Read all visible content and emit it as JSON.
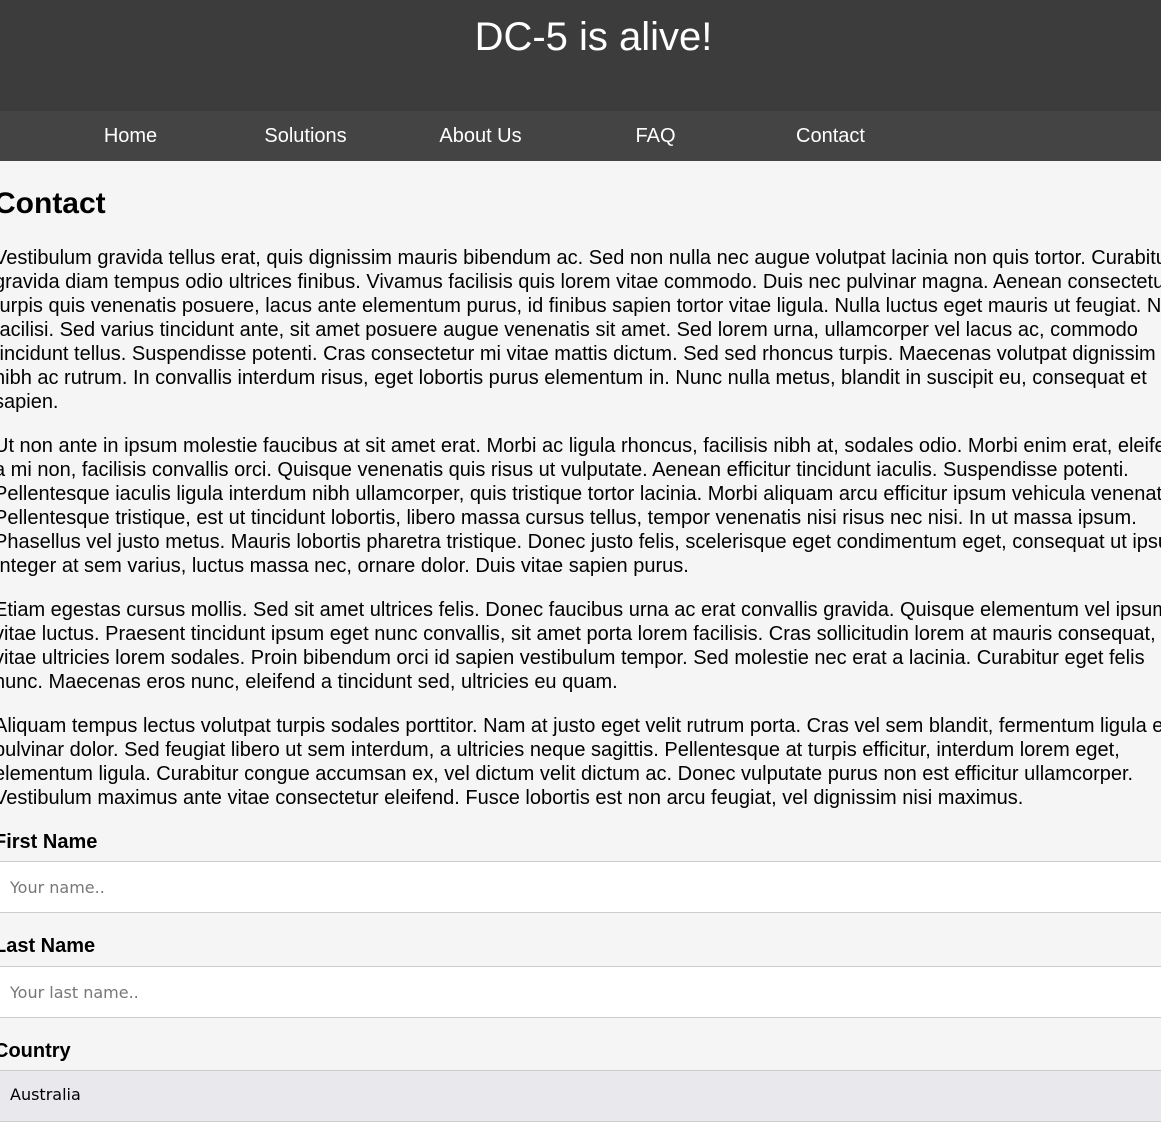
{
  "header": {
    "title": "DC-5 is alive!"
  },
  "nav": {
    "items": [
      {
        "label": "Home"
      },
      {
        "label": "Solutions"
      },
      {
        "label": "About Us"
      },
      {
        "label": "FAQ"
      },
      {
        "label": "Contact"
      }
    ]
  },
  "main": {
    "title": "Contact",
    "paragraphs": [
      {
        "lines": [
          "Vestibulum gravida tellus erat, quis dignissim mauris bibendum ac. Sed non nulla nec augue volutpat lacinia non quis tortor. Curabitur",
          "gravida diam tempus odio ultrices finibus. Vivamus facilisis quis lorem vitae commodo. Duis nec pulvinar magna. Aenean consectetur",
          "turpis quis venenatis posuere, lacus ante elementum purus, id finibus sapien tortor vitae ligula. Nulla luctus eget mauris ut feugiat. Nam",
          "facilisi. Sed varius tincidunt ante, sit amet posuere augue venenatis sit amet. Sed lorem urna, ullamcorper vel lacus ac, commodo",
          "tincidunt tellus. Suspendisse potenti. Cras consectetur mi vitae mattis dictum. Sed sed rhoncus turpis. Maecenas volutpat dignissim",
          "nibh ac rutrum. In convallis interdum risus, eget lobortis purus elementum in. Nunc nulla metus, blandit in suscipit eu, consequat et",
          "sapien."
        ]
      },
      {
        "lines": [
          "Ut non ante in ipsum molestie faucibus at sit amet erat. Morbi ac ligula rhoncus, facilisis nibh at, sodales odio. Morbi enim erat, eleifend",
          "a mi non, facilisis convallis orci. Quisque venenatis quis risus ut vulputate. Aenean efficitur tincidunt iaculis. Suspendisse potenti.",
          "Pellentesque iaculis ligula interdum nibh ullamcorper, quis tristique tortor lacinia. Morbi aliquam arcu efficitur ipsum vehicula venenatis.",
          "Pellentesque tristique, est ut tincidunt lobortis, libero massa cursus tellus, tempor venenatis nisi risus nec nisi. In ut massa ipsum.",
          "Phasellus vel justo metus. Mauris lobortis pharetra tristique. Donec justo felis, scelerisque eget condimentum eget, consequat ut ipsum.",
          "Integer at sem varius, luctus massa nec, ornare dolor. Duis vitae sapien purus."
        ]
      },
      {
        "lines": [
          "Etiam egestas cursus mollis. Sed sit amet ultrices felis. Donec faucibus urna ac erat convallis gravida. Quisque elementum vel ipsum",
          "vitae luctus. Praesent tincidunt ipsum eget nunc convallis, sit amet porta lorem facilisis. Cras sollicitudin lorem at mauris consequat,",
          "vitae ultricies lorem sodales. Proin bibendum orci id sapien vestibulum tempor. Sed molestie nec erat a lacinia. Curabitur eget felis",
          "nunc. Maecenas eros nunc, eleifend a tincidunt sed, ultricies eu quam."
        ]
      },
      {
        "lines": [
          "Aliquam tempus lectus volutpat turpis sodales porttitor. Nam at justo eget velit rutrum porta. Cras vel sem blandit, fermentum ligula et,",
          "pulvinar dolor. Sed feugiat libero ut sem interdum, a ultricies neque sagittis. Pellentesque at turpis efficitur, interdum lorem eget,",
          "elementum ligula. Curabitur congue accumsan ex, vel dictum velit dictum ac. Donec vulputate purus non est efficitur ullamcorper.",
          "Vestibulum maximus ante vitae consectetur eleifend. Fusce lobortis est non arcu feugiat, vel dignissim nisi maximus."
        ]
      }
    ]
  },
  "form": {
    "first_name": {
      "label": "First Name",
      "placeholder": "Your name..",
      "value": ""
    },
    "last_name": {
      "label": "Last Name",
      "placeholder": "Your last name..",
      "value": ""
    },
    "country": {
      "label": "Country",
      "selected": "Australia"
    }
  },
  "colors": {
    "header_bg": "#3c3c3c",
    "nav_bg": "#444444",
    "page_bg": "#f5f5f5",
    "nav_text": "#ffffff"
  }
}
